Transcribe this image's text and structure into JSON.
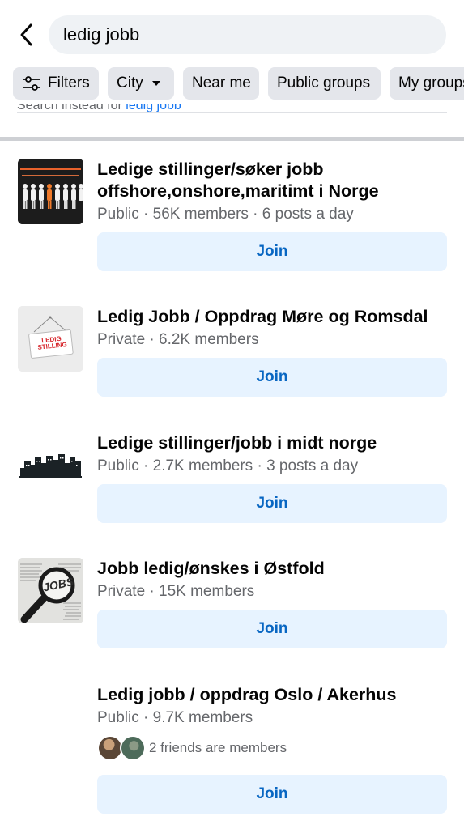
{
  "search": {
    "value": "ledig jobb"
  },
  "chips": [
    {
      "label": "Filters",
      "icon": "sliders-icon"
    },
    {
      "label": "City",
      "icon": "caret-down-icon"
    },
    {
      "label": "Near me"
    },
    {
      "label": "Public groups"
    },
    {
      "label": "My groups"
    }
  ],
  "suggestion": {
    "prefix": "Search instead for ",
    "link": "ledig jobb"
  },
  "groups": [
    {
      "name": "Ledige stillinger/søker jobb offshore,onshore,maritimt i Norge",
      "meta": "Public · 56K members · 6 posts a day",
      "join": "Join"
    },
    {
      "name": "Ledig Jobb / Oppdrag Møre og Romsdal",
      "meta": "Private · 6.2K members",
      "join": "Join",
      "sign_text": "LEDIG STILLING"
    },
    {
      "name": "Ledige stillinger/jobb i midt norge",
      "meta": "Public · 2.7K members · 3 posts a day",
      "join": "Join"
    },
    {
      "name": "Jobb ledig/ønskes i Østfold",
      "meta": "Private · 15K members",
      "join": "Join",
      "lens_text": "JOBS"
    },
    {
      "name": "Ledig jobb / oppdrag Oslo / Akerhus",
      "meta": "Public · 9.7K members",
      "friends": "2 friends are members",
      "join": "Join"
    }
  ],
  "colors": {
    "accent": "#0866c2",
    "join_bg": "#e7f3ff",
    "chip_bg": "#e4e6eb",
    "search_bg": "#eff2f5",
    "secondary_text": "#65676b"
  }
}
